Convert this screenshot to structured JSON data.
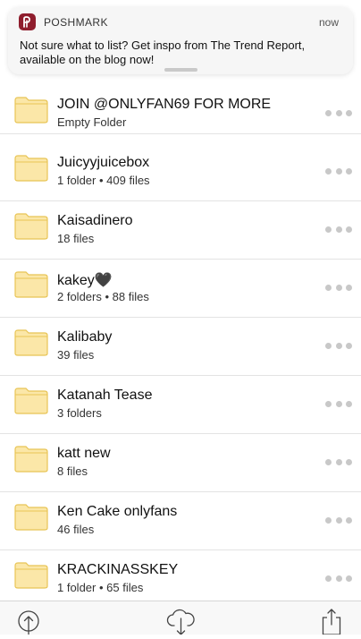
{
  "notification": {
    "app_name": "POSHMARK",
    "time": "now",
    "message": "Not sure what to list? Get inspo from The Trend Report, available on the blog now!",
    "icon": "poshmark-logo-icon",
    "accent": "#8f1d2d"
  },
  "folders": [
    {
      "name": "JOIN @ONLYFAN69 FOR MORE",
      "meta": "Empty Folder"
    },
    {
      "name": "Juicyyjuicebox",
      "meta": "1 folder • 409 files"
    },
    {
      "name": "Kaisadinero",
      "meta": "18 files"
    },
    {
      "name": "kakey🖤",
      "meta": "2 folders • 88 files"
    },
    {
      "name": "Kalibaby",
      "meta": "39 files"
    },
    {
      "name": "Katanah Tease",
      "meta": "3 folders"
    },
    {
      "name": "katt new",
      "meta": "8 files"
    },
    {
      "name": "Ken Cake onlyfans",
      "meta": "46 files"
    },
    {
      "name": "KRACKINASSKEY",
      "meta": "1 folder • 65 files"
    }
  ],
  "toolbar": {
    "upload_icon": "upload-icon",
    "download_icon": "cloud-download-icon",
    "share_icon": "share-icon"
  },
  "colors": {
    "folder_fill": "#fbe7a8",
    "folder_stroke": "#e8c455",
    "more_dots": "#c8c8c8"
  }
}
